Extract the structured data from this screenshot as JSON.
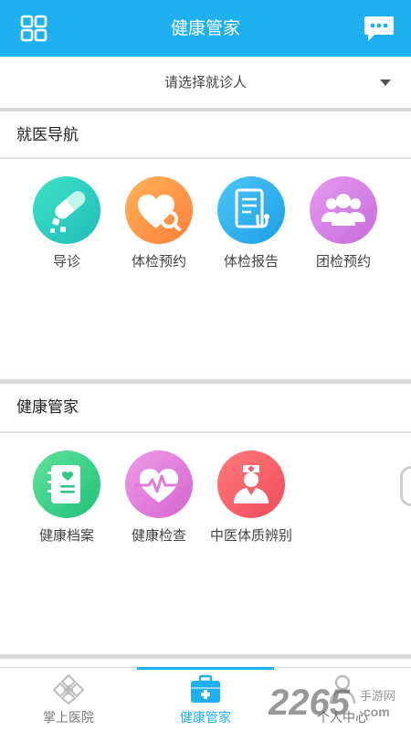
{
  "header": {
    "title": "健康管家"
  },
  "patient_selector": {
    "placeholder": "请选择就诊人"
  },
  "sections": [
    {
      "title": "就医导航",
      "items": [
        {
          "label": "导诊",
          "color": "#29d3c0"
        },
        {
          "label": "体检预约",
          "color": "#ff9a4a"
        },
        {
          "label": "体检报告",
          "color": "#2db4f0"
        },
        {
          "label": "团检预约",
          "color": "#d47ee6"
        }
      ]
    },
    {
      "title": "健康管家",
      "items": [
        {
          "label": "健康档案",
          "color": "#3dd08a"
        },
        {
          "label": "健康检查",
          "color": "#e07ad8"
        },
        {
          "label": "中医体质辨别",
          "color": "#f4606a"
        }
      ]
    }
  ],
  "tabbar": {
    "items": [
      {
        "label": "掌上医院",
        "icon": "hospital-cross-icon",
        "active": false
      },
      {
        "label": "健康管家",
        "icon": "medical-kit-icon",
        "active": true
      },
      {
        "label": "个人中心",
        "icon": "person-icon",
        "active": false
      }
    ]
  },
  "watermark": {
    "text": "2265",
    "suffix": "手游网",
    "domain": ".com"
  },
  "colors": {
    "primary": "#1fb0ef",
    "background": "#ffffff",
    "separator": "#d9d9d9"
  }
}
